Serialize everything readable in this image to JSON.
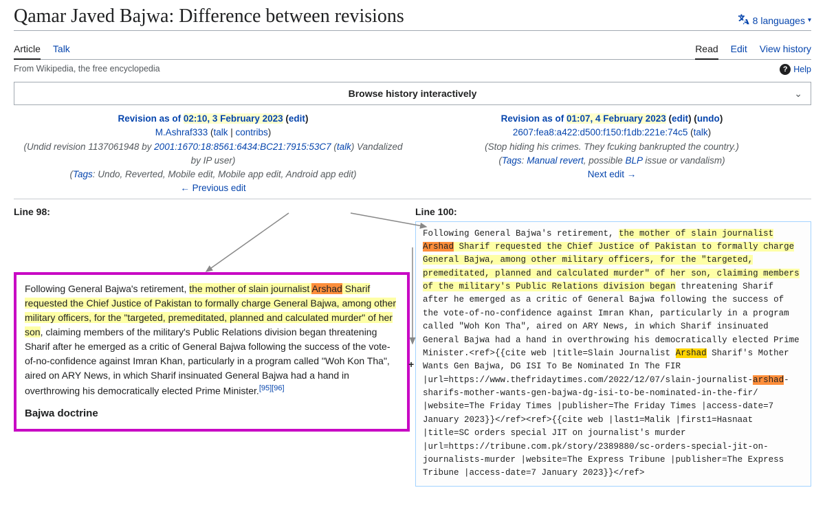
{
  "header": {
    "title": "Qamar Javed Bajwa: Difference between revisions",
    "languages_label": "8 languages"
  },
  "tabs_left": [
    {
      "label": "Article",
      "active": true
    },
    {
      "label": "Talk",
      "active": false
    }
  ],
  "tabs_right": [
    {
      "label": "Read",
      "active": true
    },
    {
      "label": "Edit",
      "active": false
    },
    {
      "label": "View history",
      "active": false
    }
  ],
  "subheader": {
    "tagline": "From Wikipedia, the free encyclopedia",
    "help": "Help"
  },
  "browse_label": "Browse history interactively",
  "left_rev": {
    "prefix": "Revision as of ",
    "timestamp": "02:10, 3 February 2023",
    "edit": "edit",
    "user": "M.Ashraf333",
    "talk": "talk",
    "contribs": "contribs",
    "summary_prefix": "(Undid revision 1137061948 by ",
    "ip": "2001:1670:18:8561:6434:BC21:7915:53C7",
    "talk2": "talk",
    "summary_suffix": ") Vandalized by IP user)",
    "tags_label": "Tags",
    "tags_rest": ": Undo, Reverted, Mobile edit, Mobile app edit, Android app edit)",
    "prev": "← Previous edit"
  },
  "right_rev": {
    "prefix": "Revision as of ",
    "timestamp": "01:07, 4 February 2023",
    "edit": "edit",
    "undo": "undo",
    "ip": "2607:fea8:a422:d500:f150:f1db:221e:74c5",
    "talk": "talk",
    "summary": "(Stop hiding his crimes. They fcuking bankrupted the country.)",
    "tags_label": "Tags",
    "manual_revert": "Manual revert",
    "possible": ", possible ",
    "blp": "BLP",
    "tags_rest": " issue or vandalism)",
    "next": "Next edit →"
  },
  "diff": {
    "left_line": "Line 98:",
    "right_line": "Line 100:",
    "plus": "+",
    "left_para": {
      "t1": "Following General Bajwa's retirement, ",
      "h1": "the mother of slain journalist ",
      "arshad": "Arshad",
      "h2": " Sharif requested the Chief Justice of Pakistan to formally charge General Bajwa, among other military officers, for the \"targeted, premeditated, planned and calculated murder\" of her son",
      "t2": ", claiming members of the military's Public Relations division began threatening Sharif after he emerged as a critic of General Bajwa following the success of the vote-of-no-confidence against Imran Khan, particularly in a program called \"Woh Kon Tha\", aired on ARY News, in which Sharif insinuated General Bajwa had a hand in overthrowing his democratically elected Prime Minister.",
      "ref1": "[95]",
      "ref2": "[96]",
      "subhead": "Bajwa doctrine"
    },
    "right_para": {
      "t1": "Following General Bajwa's retirement, ",
      "h1": "the mother of slain journalist ",
      "arshad": "Arshad",
      "h2": " Sharif requested the Chief Justice of Pakistan to formally charge General Bajwa, among other military officers, for the \"targeted, premeditated, planned and calculated murder\" of her son, claiming members of the military's Public Relations division began",
      "t2": " threatening Sharif after he emerged as a critic of General Bajwa following the success of the vote-of-no-confidence against Imran Khan, particularly in a program called \"Woh Kon Tha\", aired on ARY News, in which Sharif insinuated General Bajwa had a hand in overthrowing his democratically elected Prime Minister.<ref>{{cite web |title=Slain Journalist ",
      "arshad2": "Arshad",
      "t3": " Sharif's Mother Wants Gen Bajwa, DG ISI To Be Nominated In The FIR |url=https://www.thefridaytimes.com/2022/12/07/slain-journalist-",
      "arshad3": "arshad",
      "t4": "-sharifs-mother-wants-gen-bajwa-dg-isi-to-be-nominated-in-the-fir/ |website=The Friday Times |publisher=The Friday Times |access-date=7 January 2023}}</ref><ref>{{cite web |last1=Malik |first1=Hasnaat |title=SC orders special JIT on journalist's murder |url=https://tribune.com.pk/story/2389880/sc-orders-special-jit-on-journalists-murder |website=The Express Tribune |publisher=The Express Tribune |access-date=7 January 2023}}</ref>"
    }
  }
}
